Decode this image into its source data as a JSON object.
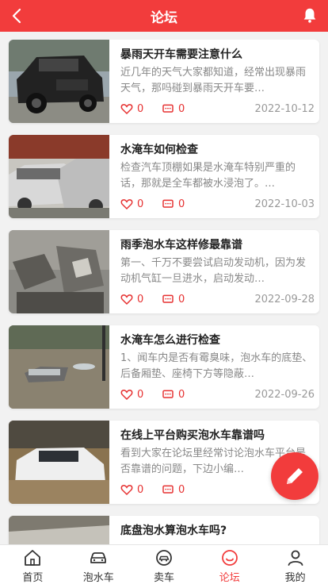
{
  "header": {
    "title": "论坛"
  },
  "posts": [
    {
      "title": "暴雨天开车需要注意什么",
      "excerpt": "近几年的天气大家都知道，经常出现暴雨天气，那吗碰到暴雨天开车要…",
      "likes": "0",
      "comments": "0",
      "date": "2022-10-12"
    },
    {
      "title": "水淹车如何检查",
      "excerpt": "检查汽车顶棚如果是水淹车特别严重的话，那就是全车都被水浸泡了。…",
      "likes": "0",
      "comments": "0",
      "date": "2022-10-03"
    },
    {
      "title": "雨季泡水车这样修最靠谱",
      "excerpt": "第一、千万不要尝试启动发动机，因为发动机气缸一旦进水，启动发动…",
      "likes": "0",
      "comments": "0",
      "date": "2022-09-28"
    },
    {
      "title": "水淹车怎么进行检查",
      "excerpt": "1、闻车内是否有霉臭味，泡水车的底垫、后备厢垫、座椅下方等隐蔽…",
      "likes": "0",
      "comments": "0",
      "date": "2022-09-26"
    },
    {
      "title": "在线上平台购买泡水车靠谱吗",
      "excerpt": "看到大家在论坛里经常讨论泡水车平台是否靠谱的问题，下边小编…",
      "likes": "0",
      "comments": "0",
      "date": ""
    },
    {
      "title": "底盘泡水算泡水车吗?",
      "excerpt": "",
      "likes": "",
      "comments": "",
      "date": ""
    }
  ],
  "tabbar": {
    "items": [
      {
        "label": "首页",
        "icon": "home-icon"
      },
      {
        "label": "泡水车",
        "icon": "car-icon"
      },
      {
        "label": "卖车",
        "icon": "sell-car-icon"
      },
      {
        "label": "论坛",
        "icon": "forum-icon",
        "active": true
      },
      {
        "label": "我的",
        "icon": "user-icon"
      }
    ]
  },
  "colors": {
    "brand": "#f23c3c",
    "muted": "#888888",
    "date": "#999999"
  },
  "fab_icon": "pencil-icon"
}
